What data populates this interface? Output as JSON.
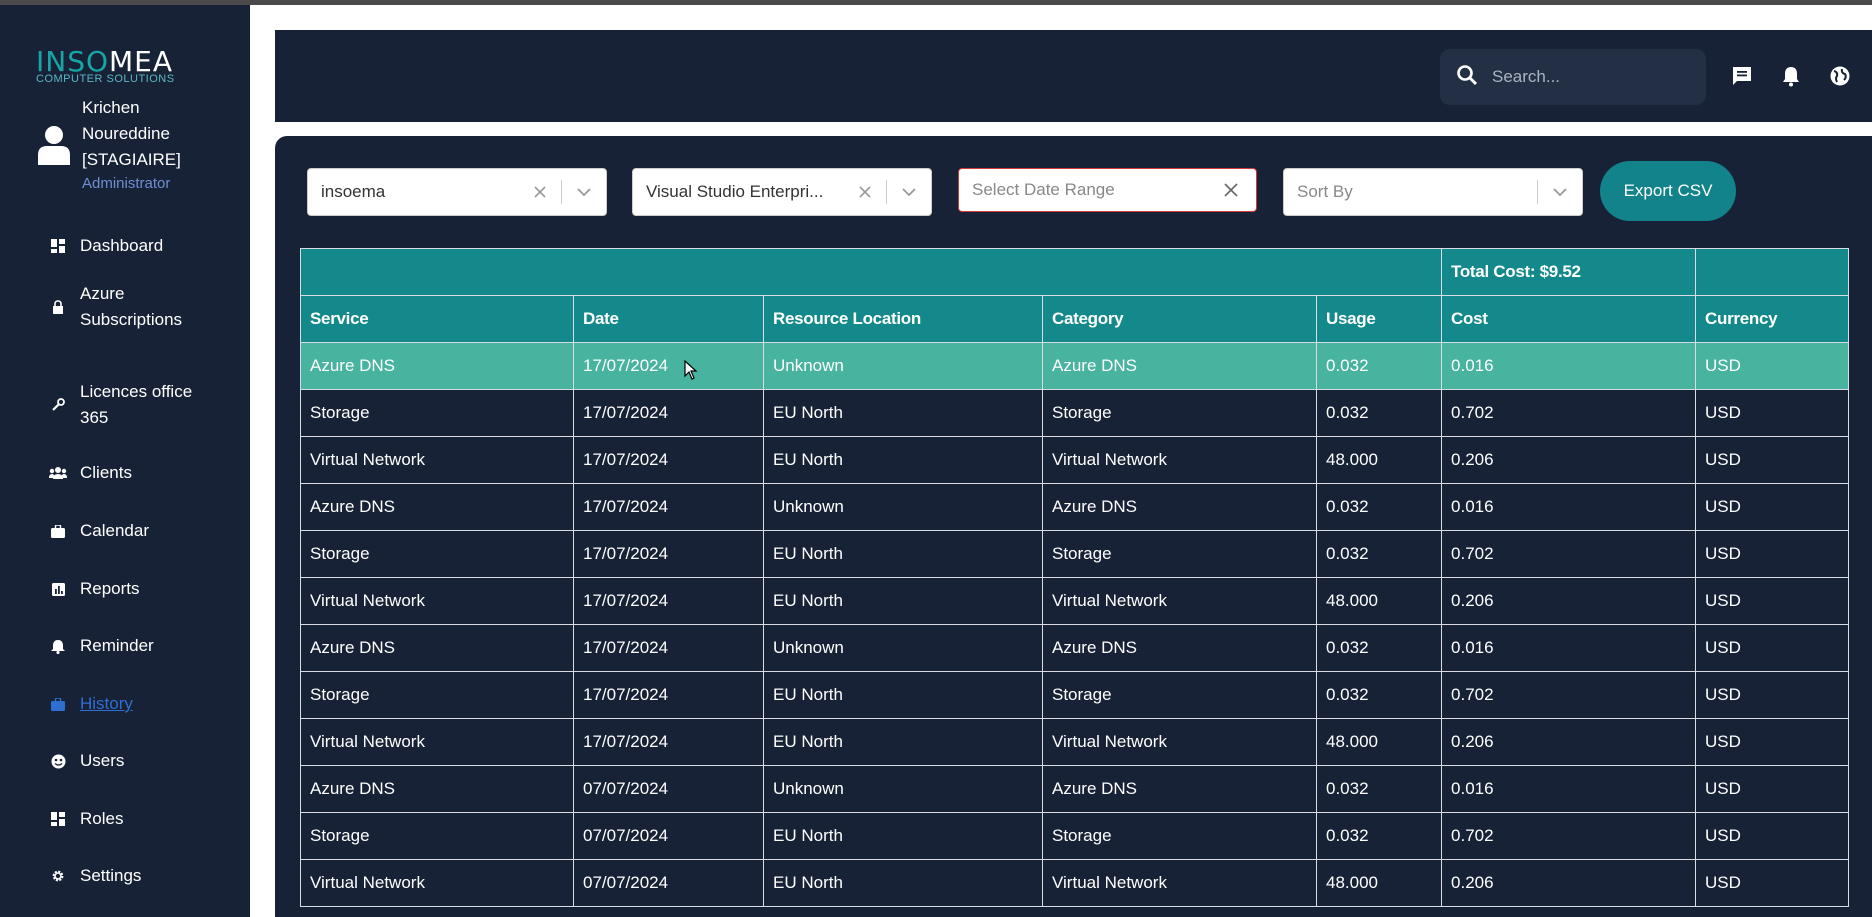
{
  "brand": {
    "logo_main_a": "INSO",
    "logo_main_b": "MEA",
    "logo_sub": "COMPUTER SOLUTIONS"
  },
  "user": {
    "name": "Krichen Noureddine [STAGIAIRE]",
    "role": "Administrator"
  },
  "nav": [
    {
      "label": "Dashboard",
      "icon": "dashboard-icon"
    },
    {
      "label": "Azure Subscriptions",
      "icon": "lock-icon"
    },
    {
      "label": "Licences office 365",
      "icon": "wrench-icon"
    },
    {
      "label": "Clients",
      "icon": "users-icon"
    },
    {
      "label": "Calendar",
      "icon": "briefcase-icon"
    },
    {
      "label": "Reports",
      "icon": "report-icon"
    },
    {
      "label": "Reminder",
      "icon": "bell-icon"
    },
    {
      "label": "History",
      "icon": "briefcase-icon",
      "active": true
    },
    {
      "label": "Users",
      "icon": "user-circle-icon"
    },
    {
      "label": "Roles",
      "icon": "dashboard-icon"
    },
    {
      "label": "Settings",
      "icon": "gear-icon"
    }
  ],
  "header": {
    "search_placeholder": "Search..."
  },
  "filters": {
    "client": "insoema",
    "subscription": "Visual Studio Enterpri...",
    "date_placeholder": "Select Date Range",
    "sort_placeholder": "Sort By",
    "export_label": "Export CSV"
  },
  "table": {
    "total_cost": "Total Cost: $9.52",
    "columns": [
      "Service",
      "Date",
      "Resource Location",
      "Category",
      "Usage",
      "Cost",
      "Currency"
    ],
    "rows": [
      [
        "Azure DNS",
        "17/07/2024",
        "Unknown",
        "Azure DNS",
        "0.032",
        "0.016",
        "USD"
      ],
      [
        "Storage",
        "17/07/2024",
        "EU North",
        "Storage",
        "0.032",
        "0.702",
        "USD"
      ],
      [
        "Virtual Network",
        "17/07/2024",
        "EU North",
        "Virtual Network",
        "48.000",
        "0.206",
        "USD"
      ],
      [
        "Azure DNS",
        "17/07/2024",
        "Unknown",
        "Azure DNS",
        "0.032",
        "0.016",
        "USD"
      ],
      [
        "Storage",
        "17/07/2024",
        "EU North",
        "Storage",
        "0.032",
        "0.702",
        "USD"
      ],
      [
        "Virtual Network",
        "17/07/2024",
        "EU North",
        "Virtual Network",
        "48.000",
        "0.206",
        "USD"
      ],
      [
        "Azure DNS",
        "17/07/2024",
        "Unknown",
        "Azure DNS",
        "0.032",
        "0.016",
        "USD"
      ],
      [
        "Storage",
        "17/07/2024",
        "EU North",
        "Storage",
        "0.032",
        "0.702",
        "USD"
      ],
      [
        "Virtual Network",
        "17/07/2024",
        "EU North",
        "Virtual Network",
        "48.000",
        "0.206",
        "USD"
      ],
      [
        "Azure DNS",
        "07/07/2024",
        "Unknown",
        "Azure DNS",
        "0.032",
        "0.016",
        "USD"
      ],
      [
        "Storage",
        "07/07/2024",
        "EU North",
        "Storage",
        "0.032",
        "0.702",
        "USD"
      ],
      [
        "Virtual Network",
        "07/07/2024",
        "EU North",
        "Virtual Network",
        "48.000",
        "0.206",
        "USD"
      ]
    ]
  },
  "colors": {
    "sidebar_bg": "#172236",
    "accent_teal": "#13898c",
    "highlight_row": "#48b39e",
    "active_link": "#2f6fd1"
  }
}
